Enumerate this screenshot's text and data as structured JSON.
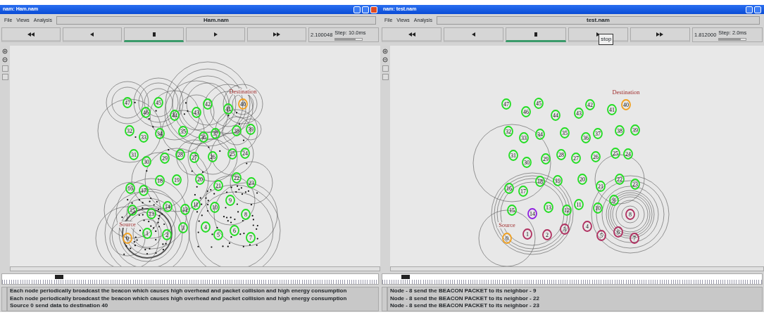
{
  "windows": [
    {
      "title": "nam: Ham.nam",
      "window_buttons": [
        {
          "kind": "minimize"
        },
        {
          "kind": "maximize"
        },
        {
          "kind": "close"
        }
      ],
      "menu": [
        "File",
        "Views",
        "Analysis"
      ],
      "file_name": "Ham.nam",
      "controls": [
        {
          "kind": "rewind",
          "selected": false
        },
        {
          "kind": "back",
          "selected": false
        },
        {
          "kind": "stop",
          "selected": true
        },
        {
          "kind": "play",
          "selected": false
        },
        {
          "kind": "forward",
          "selected": false
        }
      ],
      "time": "2.100048",
      "step_slider": {
        "label": "Step: 10.0ms",
        "level": 0.75
      },
      "nodes": [
        {
          "label": "47",
          "color": "#22dd22"
        },
        {
          "label": "45",
          "color": "#22dd22"
        },
        {
          "label": "46",
          "color": "#22dd22"
        },
        {
          "label": "44",
          "color": "#22dd22"
        },
        {
          "label": "42",
          "color": "#22dd22"
        },
        {
          "label": "43",
          "color": "#22dd22"
        },
        {
          "label": "41",
          "color": "#22dd22"
        },
        {
          "label": "40",
          "color": "#f0a020"
        },
        {
          "label": "32",
          "color": "#22dd22"
        },
        {
          "label": "33",
          "color": "#22dd22"
        },
        {
          "label": "34",
          "color": "#22dd22"
        },
        {
          "label": "35",
          "color": "#22dd22"
        },
        {
          "label": "36",
          "color": "#22dd22"
        },
        {
          "label": "37",
          "color": "#22dd22"
        },
        {
          "label": "38",
          "color": "#22dd22"
        },
        {
          "label": "39",
          "color": "#22dd22"
        },
        {
          "label": "31",
          "color": "#22dd22"
        },
        {
          "label": "30",
          "color": "#22dd22"
        },
        {
          "label": "29",
          "color": "#22dd22"
        },
        {
          "label": "28",
          "color": "#22dd22"
        },
        {
          "label": "27",
          "color": "#22dd22"
        },
        {
          "label": "26",
          "color": "#22dd22"
        },
        {
          "label": "25",
          "color": "#22dd22"
        },
        {
          "label": "24",
          "color": "#22dd22"
        },
        {
          "label": "18",
          "color": "#22dd22"
        },
        {
          "label": "19",
          "color": "#22dd22"
        },
        {
          "label": "20",
          "color": "#22dd22"
        },
        {
          "label": "16",
          "color": "#22dd22"
        },
        {
          "label": "17",
          "color": "#22dd22"
        },
        {
          "label": "21",
          "color": "#22dd22"
        },
        {
          "label": "22",
          "color": "#22dd22"
        },
        {
          "label": "23",
          "color": "#22dd22"
        },
        {
          "label": "9",
          "color": "#22dd22"
        },
        {
          "label": "15",
          "color": "#22dd22"
        },
        {
          "label": "13",
          "color": "#22dd22"
        },
        {
          "label": "14",
          "color": "#22dd22"
        },
        {
          "label": "12",
          "color": "#22dd22"
        },
        {
          "label": "11",
          "color": "#22dd22"
        },
        {
          "label": "10",
          "color": "#22dd22"
        },
        {
          "label": "8",
          "color": "#22dd22"
        },
        {
          "label": "0",
          "color": "#f0a020"
        },
        {
          "label": "1",
          "color": "#22dd22"
        },
        {
          "label": "2",
          "color": "#22dd22"
        },
        {
          "label": "3",
          "color": "#22dd22"
        },
        {
          "label": "4",
          "color": "#22dd22"
        },
        {
          "label": "5",
          "color": "#22dd22"
        },
        {
          "label": "6",
          "color": "#22dd22"
        },
        {
          "label": "7",
          "color": "#22dd22"
        }
      ],
      "node_tags": [
        "Destination",
        "Source"
      ],
      "timeline": {
        "level": 0.14
      },
      "messages": [
        "Each node periodically broadcast the beacon which causes high overhead and packet collision and high energy consumption",
        "Each node periodically broadcast the beacon which causes high overhead and packet collision and high energy consumption",
        "Source 0 send data to destination 40"
      ]
    },
    {
      "title": "nam: test.nam",
      "window_buttons": [
        {
          "kind": "minimize"
        },
        {
          "kind": "maximize"
        }
      ],
      "menu": [
        "File",
        "Views",
        "Analysis"
      ],
      "file_name": "test.nam",
      "controls": [
        {
          "kind": "rewind",
          "selected": false
        },
        {
          "kind": "back",
          "selected": false
        },
        {
          "kind": "stop",
          "selected": true
        },
        {
          "kind": "play",
          "selected": false
        },
        {
          "kind": "forward",
          "selected": false
        }
      ],
      "tooltip": "stop",
      "time": "1.812000",
      "step_slider": {
        "label": "Step: 2.0ms",
        "level": 0.8
      },
      "nodes": [
        {
          "label": "47",
          "color": "#22dd22"
        },
        {
          "label": "46",
          "color": "#22dd22"
        },
        {
          "label": "45",
          "color": "#22dd22"
        },
        {
          "label": "44",
          "color": "#22dd22"
        },
        {
          "label": "43",
          "color": "#22dd22"
        },
        {
          "label": "42",
          "color": "#22dd22"
        },
        {
          "label": "41",
          "color": "#22dd22"
        },
        {
          "label": "40",
          "color": "#f0a020"
        },
        {
          "label": "32",
          "color": "#22dd22"
        },
        {
          "label": "33",
          "color": "#22dd22"
        },
        {
          "label": "34",
          "color": "#22dd22"
        },
        {
          "label": "35",
          "color": "#22dd22"
        },
        {
          "label": "36",
          "color": "#22dd22"
        },
        {
          "label": "37",
          "color": "#22dd22"
        },
        {
          "label": "38",
          "color": "#22dd22"
        },
        {
          "label": "39",
          "color": "#22dd22"
        },
        {
          "label": "31",
          "color": "#22dd22"
        },
        {
          "label": "30",
          "color": "#22dd22"
        },
        {
          "label": "29",
          "color": "#22dd22"
        },
        {
          "label": "28",
          "color": "#22dd22"
        },
        {
          "label": "27",
          "color": "#22dd22"
        },
        {
          "label": "26",
          "color": "#22dd22"
        },
        {
          "label": "25",
          "color": "#22dd22"
        },
        {
          "label": "24",
          "color": "#22dd22"
        },
        {
          "label": "18",
          "color": "#22dd22"
        },
        {
          "label": "19",
          "color": "#22dd22"
        },
        {
          "label": "20",
          "color": "#22dd22"
        },
        {
          "label": "16",
          "color": "#22dd22"
        },
        {
          "label": "17",
          "color": "#22dd22"
        },
        {
          "label": "21",
          "color": "#22dd22"
        },
        {
          "label": "22",
          "color": "#22dd22"
        },
        {
          "label": "23",
          "color": "#22dd22"
        },
        {
          "label": "9",
          "color": "#22dd22"
        },
        {
          "label": "15",
          "color": "#22dd22"
        },
        {
          "label": "14",
          "color": "#9020e0"
        },
        {
          "label": "13",
          "color": "#22dd22"
        },
        {
          "label": "12",
          "color": "#22dd22"
        },
        {
          "label": "11",
          "color": "#22dd22"
        },
        {
          "label": "10",
          "color": "#22dd22"
        },
        {
          "label": "8",
          "color": "#b03060"
        },
        {
          "label": "0",
          "color": "#f0a020"
        },
        {
          "label": "1",
          "color": "#b03060"
        },
        {
          "label": "2",
          "color": "#b03060"
        },
        {
          "label": "3",
          "color": "#b03060"
        },
        {
          "label": "4",
          "color": "#b03060"
        },
        {
          "label": "5",
          "color": "#b03060"
        },
        {
          "label": "6",
          "color": "#b03060"
        },
        {
          "label": "7",
          "color": "#b03060"
        }
      ],
      "node_tags": [
        "Destination",
        "Source"
      ],
      "timeline": {
        "level": 0.05
      },
      "messages": [
        "Node - 8 send the BEACON PACKET to its neighbor - 9",
        "Node - 8 send the BEACON PACKET to its neighbor - 22",
        "Node - 8 send the BEACON PACKET to its neighbor - 23"
      ]
    }
  ]
}
